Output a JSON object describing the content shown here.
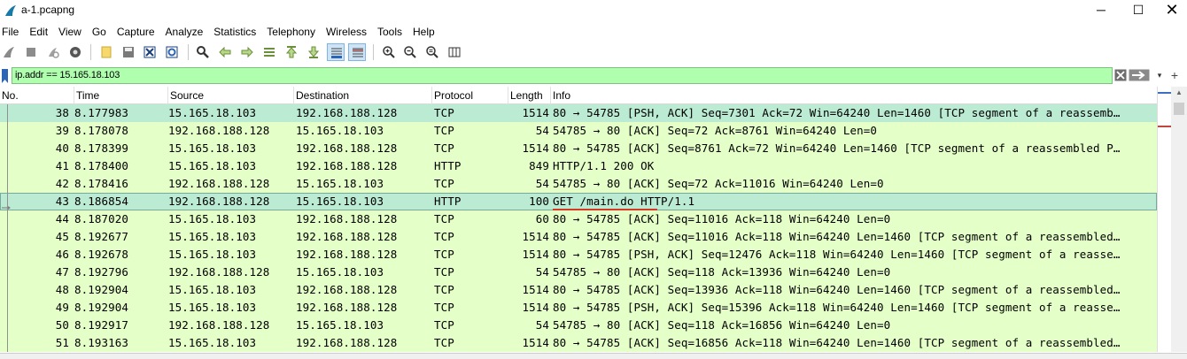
{
  "window": {
    "title": "a-1.pcapng",
    "minimize": "─",
    "maximize": "☐",
    "close": "✕"
  },
  "menu": [
    "File",
    "Edit",
    "View",
    "Go",
    "Capture",
    "Analyze",
    "Statistics",
    "Telephony",
    "Wireless",
    "Tools",
    "Help"
  ],
  "toolbar": {
    "icons": [
      "shark-fin-start-icon",
      "stop-capture-icon",
      "restart-capture-icon",
      "capture-options-icon",
      "open-file-icon",
      "save-file-icon",
      "close-file-icon",
      "reload-file-icon",
      "find-packet-icon",
      "go-back-icon",
      "go-forward-icon",
      "go-to-packet-icon",
      "go-first-packet-icon",
      "go-last-packet-icon",
      "autoscroll-icon",
      "colorize-icon",
      "zoom-in-icon",
      "zoom-out-icon",
      "normal-size-icon",
      "resize-columns-icon"
    ]
  },
  "filter": {
    "value": "ip.addr == 15.165.18.103",
    "dropdown": "▾",
    "plus": "+"
  },
  "columns": {
    "no": "No.",
    "time": "Time",
    "source": "Source",
    "destination": "Destination",
    "protocol": "Protocol",
    "length": "Length",
    "info": "Info"
  },
  "packets": [
    {
      "no": "38",
      "time": "8.177983",
      "src": "15.165.18.103",
      "dst": "192.168.188.128",
      "proto": "TCP",
      "len": "1514",
      "info": "80 → 54785 [PSH, ACK] Seq=7301 Ack=72 Win=64240 Len=1460 [TCP segment of a reassemb…"
    },
    {
      "no": "39",
      "time": "8.178078",
      "src": "192.168.188.128",
      "dst": "15.165.18.103",
      "proto": "TCP",
      "len": "54",
      "info": "54785 → 80 [ACK] Seq=72 Ack=8761 Win=64240 Len=0"
    },
    {
      "no": "40",
      "time": "8.178399",
      "src": "15.165.18.103",
      "dst": "192.168.188.128",
      "proto": "TCP",
      "len": "1514",
      "info": "80 → 54785 [ACK] Seq=8761 Ack=72 Win=64240 Len=1460 [TCP segment of a reassembled P…"
    },
    {
      "no": "41",
      "time": "8.178400",
      "src": "15.165.18.103",
      "dst": "192.168.188.128",
      "proto": "HTTP",
      "len": "849",
      "info": "HTTP/1.1 200 OK"
    },
    {
      "no": "42",
      "time": "8.178416",
      "src": "192.168.188.128",
      "dst": "15.165.18.103",
      "proto": "TCP",
      "len": "54",
      "info": "54785 → 80 [ACK] Seq=72 Ack=11016 Win=64240 Len=0"
    },
    {
      "no": "43",
      "time": "8.186854",
      "src": "192.168.188.128",
      "dst": "15.165.18.103",
      "proto": "HTTP",
      "len": "100",
      "info": "GET /main.do HTTP/1.1"
    },
    {
      "no": "44",
      "time": "8.187020",
      "src": "15.165.18.103",
      "dst": "192.168.188.128",
      "proto": "TCP",
      "len": "60",
      "info": "80 → 54785 [ACK] Seq=11016 Ack=118 Win=64240 Len=0"
    },
    {
      "no": "45",
      "time": "8.192677",
      "src": "15.165.18.103",
      "dst": "192.168.188.128",
      "proto": "TCP",
      "len": "1514",
      "info": "80 → 54785 [ACK] Seq=11016 Ack=118 Win=64240 Len=1460 [TCP segment of a reassembled…"
    },
    {
      "no": "46",
      "time": "8.192678",
      "src": "15.165.18.103",
      "dst": "192.168.188.128",
      "proto": "TCP",
      "len": "1514",
      "info": "80 → 54785 [PSH, ACK] Seq=12476 Ack=118 Win=64240 Len=1460 [TCP segment of a reasse…"
    },
    {
      "no": "47",
      "time": "8.192796",
      "src": "192.168.188.128",
      "dst": "15.165.18.103",
      "proto": "TCP",
      "len": "54",
      "info": "54785 → 80 [ACK] Seq=118 Ack=13936 Win=64240 Len=0"
    },
    {
      "no": "48",
      "time": "8.192904",
      "src": "15.165.18.103",
      "dst": "192.168.188.128",
      "proto": "TCP",
      "len": "1514",
      "info": "80 → 54785 [ACK] Seq=13936 Ack=118 Win=64240 Len=1460 [TCP segment of a reassembled…"
    },
    {
      "no": "49",
      "time": "8.192904",
      "src": "15.165.18.103",
      "dst": "192.168.188.128",
      "proto": "TCP",
      "len": "1514",
      "info": "80 → 54785 [PSH, ACK] Seq=15396 Ack=118 Win=64240 Len=1460 [TCP segment of a reasse…"
    },
    {
      "no": "50",
      "time": "8.192917",
      "src": "192.168.188.128",
      "dst": "15.165.18.103",
      "proto": "TCP",
      "len": "54",
      "info": "54785 → 80 [ACK] Seq=118 Ack=16856 Win=64240 Len=0"
    },
    {
      "no": "51",
      "time": "8.193163",
      "src": "15.165.18.103",
      "dst": "192.168.188.128",
      "proto": "TCP",
      "len": "1514",
      "info": "80 → 54785 [ACK] Seq=16856 Ack=118 Win=64240 Len=1460 [TCP segment of a reassembled…"
    }
  ],
  "colors": {
    "filter_valid_bg": "#afffaf",
    "row_bg": "#e4ffc7",
    "row_selected_bg": "#bcebd4"
  }
}
